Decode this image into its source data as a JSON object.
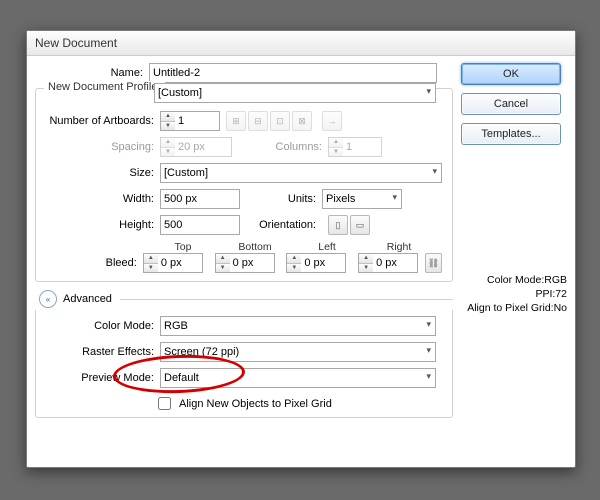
{
  "window": {
    "title": "New Document"
  },
  "buttons": {
    "ok": "OK",
    "cancel": "Cancel",
    "templates": "Templates..."
  },
  "info": {
    "colorMode": "Color Mode:RGB",
    "ppi": "PPI:72",
    "align": "Align to Pixel Grid:No"
  },
  "name": {
    "label": "Name:",
    "value": "Untitled-2"
  },
  "profile": {
    "legend": "New Document Profile:",
    "value": "[Custom]"
  },
  "artboards": {
    "label": "Number of Artboards:",
    "value": "1"
  },
  "spacing": {
    "label": "Spacing:",
    "value": "20 px"
  },
  "columns": {
    "label": "Columns:",
    "value": "1"
  },
  "size": {
    "label": "Size:",
    "value": "[Custom]"
  },
  "width": {
    "label": "Width:",
    "value": "500 px"
  },
  "height": {
    "label": "Height:",
    "value": "500"
  },
  "units": {
    "label": "Units:",
    "value": "Pixels"
  },
  "orientation": {
    "label": "Orientation:"
  },
  "bleed": {
    "label": "Bleed:",
    "top": "Top",
    "bottom": "Bottom",
    "left": "Left",
    "right": "Right",
    "v": "0 px"
  },
  "advanced": {
    "label": "Advanced"
  },
  "colorMode": {
    "label": "Color Mode:",
    "value": "RGB"
  },
  "raster": {
    "label": "Raster Effects:",
    "value": "Screen (72 ppi)"
  },
  "preview": {
    "label": "Preview Mode:",
    "value": "Default"
  },
  "alignCheck": {
    "label": "Align New Objects to Pixel Grid"
  }
}
